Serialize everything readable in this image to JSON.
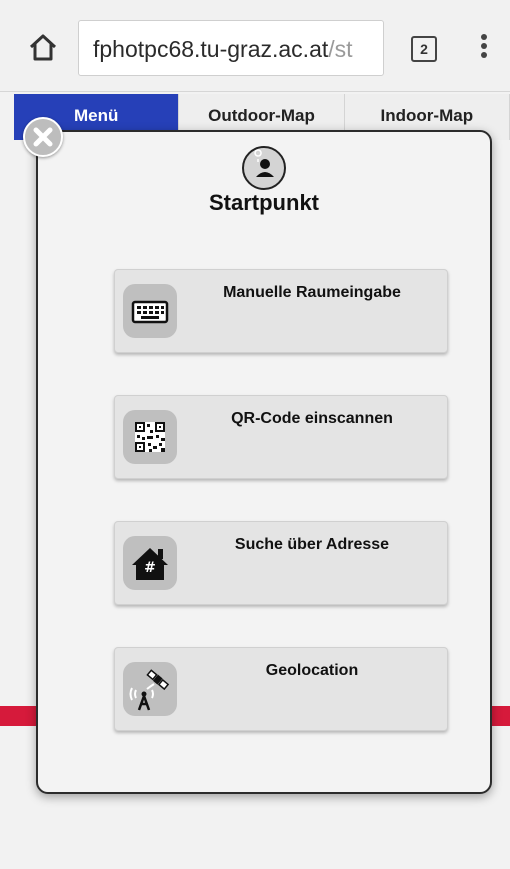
{
  "browser": {
    "url_host": "fphotpc68.tu-graz.ac.at",
    "url_path": "/st",
    "tab_count": "2"
  },
  "nav": {
    "tabs": [
      {
        "label": "Menü"
      },
      {
        "label": "Outdoor-Map"
      },
      {
        "label": "Indoor-Map"
      }
    ]
  },
  "modal": {
    "title": "Startpunkt",
    "options": [
      {
        "label": "Manuelle Raumeingabe",
        "icon": "keyboard-icon"
      },
      {
        "label": "QR-Code einscannen",
        "icon": "qr-code-icon"
      },
      {
        "label": "Suche über Adresse",
        "icon": "house-address-icon"
      },
      {
        "label": "Geolocation",
        "icon": "satellite-tower-icon"
      }
    ]
  },
  "colors": {
    "active_tab": "#2640b8",
    "accent_red": "#d61a3b"
  }
}
